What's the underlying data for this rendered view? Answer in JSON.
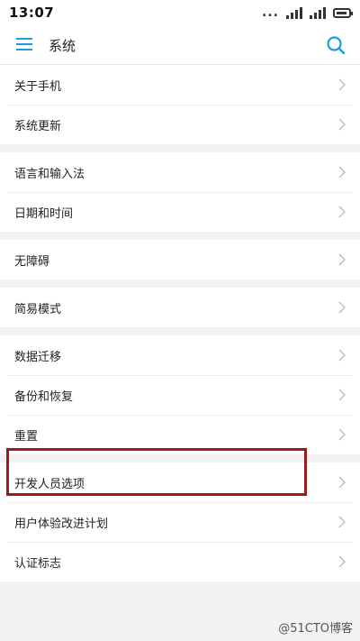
{
  "status": {
    "time": "13:07",
    "dots": "..."
  },
  "header": {
    "title": "系统"
  },
  "groups": [
    {
      "items": [
        {
          "label": "关于手机"
        },
        {
          "label": "系统更新"
        }
      ]
    },
    {
      "items": [
        {
          "label": "语言和输入法"
        },
        {
          "label": "日期和时间"
        }
      ]
    },
    {
      "items": [
        {
          "label": "无障碍"
        }
      ]
    },
    {
      "items": [
        {
          "label": "简易模式"
        }
      ]
    },
    {
      "items": [
        {
          "label": "数据迁移"
        },
        {
          "label": "备份和恢复"
        },
        {
          "label": "重置"
        }
      ]
    },
    {
      "items": [
        {
          "label": "开发人员选项"
        },
        {
          "label": "用户体验改进计划"
        },
        {
          "label": "认证标志"
        }
      ]
    }
  ],
  "colors": {
    "accent": "#1a9fdb",
    "highlight": "#9b1b1b"
  },
  "icons": {
    "menu": "hamburger-menu-icon",
    "search": "search-icon",
    "chevron": "chevron-right-icon"
  },
  "watermark": "@51CTO博客"
}
